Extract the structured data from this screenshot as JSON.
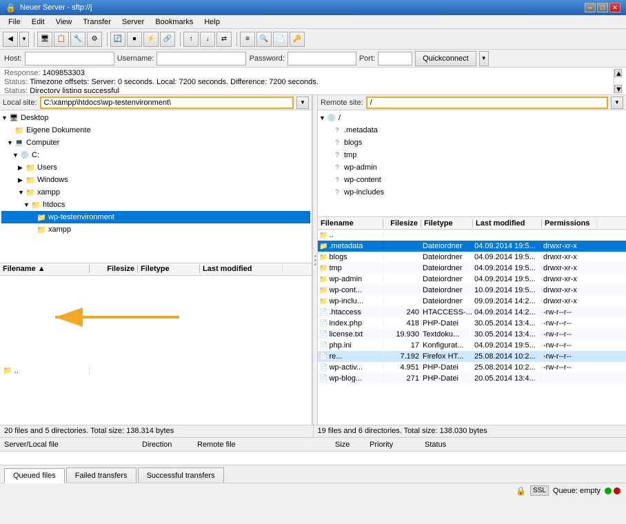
{
  "titlebar": {
    "title": "Neuer Server - sftp://j",
    "min_btn": "─",
    "max_btn": "□",
    "close_btn": "✕"
  },
  "menubar": {
    "items": [
      "File",
      "Edit",
      "View",
      "Transfer",
      "Server",
      "Bookmarks",
      "Help"
    ]
  },
  "connection": {
    "host_label": "Host:",
    "username_label": "Username:",
    "password_label": "Password:",
    "port_label": "Port:",
    "quickconnect_label": "Quickconnect",
    "host_value": "",
    "username_value": "",
    "password_value": "",
    "port_value": ""
  },
  "log": {
    "lines": [
      {
        "label": "Response:",
        "value": "1409853303"
      },
      {
        "label": "Status:",
        "value": "Timezone offsets: Server: 0 seconds. Local: 7200 seconds. Difference: 7200 seconds."
      },
      {
        "label": "Status:",
        "value": "Directory listing successful"
      }
    ]
  },
  "local_site": {
    "label": "Local site:",
    "value": "C:\\xampp\\htdocs\\wp-testenvironment\\"
  },
  "remote_site": {
    "label": "Remote site:",
    "value": "/"
  },
  "local_tree": {
    "items": [
      {
        "indent": 0,
        "label": "Desktop",
        "type": "desktop",
        "expanded": true
      },
      {
        "indent": 1,
        "label": "Eigene Dokumente",
        "type": "folder"
      },
      {
        "indent": 1,
        "label": "Computer",
        "type": "computer",
        "expanded": true
      },
      {
        "indent": 2,
        "label": "C:",
        "type": "drive",
        "expanded": true
      },
      {
        "indent": 3,
        "label": "Users",
        "type": "folder"
      },
      {
        "indent": 3,
        "label": "Windows",
        "type": "folder"
      },
      {
        "indent": 3,
        "label": "xampp",
        "type": "folder",
        "expanded": true
      },
      {
        "indent": 4,
        "label": "htdocs",
        "type": "folder",
        "expanded": true
      },
      {
        "indent": 5,
        "label": "wp-testenvironment",
        "type": "folder",
        "selected": true
      },
      {
        "indent": 5,
        "label": "xampp",
        "type": "folder"
      }
    ]
  },
  "local_files": {
    "columns": [
      "Filename",
      "Filesize",
      "Filetype",
      "Last modified"
    ],
    "rows": [
      {
        "name": "..",
        "size": "",
        "type": "",
        "modified": ""
      }
    ]
  },
  "remote_tree": {
    "items": [
      {
        "indent": 0,
        "label": "/",
        "type": "drive",
        "expanded": true
      },
      {
        "indent": 1,
        "label": ".metadata",
        "type": "question"
      },
      {
        "indent": 1,
        "label": "blogs",
        "type": "question"
      },
      {
        "indent": 1,
        "label": "tmp",
        "type": "question"
      },
      {
        "indent": 1,
        "label": "wp-admin",
        "type": "question"
      },
      {
        "indent": 1,
        "label": "wp-content",
        "type": "question"
      },
      {
        "indent": 1,
        "label": "wp-includes",
        "type": "question"
      }
    ]
  },
  "remote_files": {
    "columns": [
      "Filename",
      "Filesize",
      "Filetype",
      "Last modified",
      "Permissions"
    ],
    "rows": [
      {
        "name": "..",
        "size": "",
        "type": "",
        "modified": "",
        "perms": "",
        "folder": true
      },
      {
        "name": ".metadata",
        "size": "",
        "type": "Dateiordner",
        "modified": "04.09.2014 19:5...",
        "perms": "drwxr-xr-x",
        "folder": true,
        "selected": true
      },
      {
        "name": "blogs",
        "size": "",
        "type": "Dateiordner",
        "modified": "04.09.2014 19:5...",
        "perms": "drwxr-xr-x",
        "folder": true
      },
      {
        "name": "tmp",
        "size": "",
        "type": "Dateiordner",
        "modified": "04.09.2014 19:5...",
        "perms": "drwxr-xr-x",
        "folder": true,
        "alt": true
      },
      {
        "name": "wp-admin",
        "size": "",
        "type": "Dateiordner",
        "modified": "04.09.2014 19:5...",
        "perms": "drwxr-xr-x",
        "folder": true
      },
      {
        "name": "wp-cont...",
        "size": "",
        "type": "Dateiordner",
        "modified": "10.09.2014 19:5...",
        "perms": "drwxr-xr-x",
        "folder": true,
        "alt": true
      },
      {
        "name": "wp-inclu...",
        "size": "",
        "type": "Dateiordner",
        "modified": "09.09.2014 14:2...",
        "perms": "drwxr-xr-x",
        "folder": true
      },
      {
        "name": ".htaccess",
        "size": "240",
        "type": "HTACCESS-...",
        "modified": "04.09.2014 14:2...",
        "perms": "-rw-r--r--",
        "folder": false,
        "alt": true
      },
      {
        "name": "index.php",
        "size": "418",
        "type": "PHP-Datei",
        "modified": "30.05.2014 13:4...",
        "perms": "-rw-r--r--",
        "folder": false
      },
      {
        "name": "license.txt",
        "size": "19.930",
        "type": "Textdoku...",
        "modified": "30.05.2014 13:4...",
        "perms": "-rw-r--r--",
        "folder": false,
        "alt": true
      },
      {
        "name": "php.ini",
        "size": "17",
        "type": "Konfigurat...",
        "modified": "04.09.2014 19:5...",
        "perms": "-rw-r--r--",
        "folder": false
      },
      {
        "name": "re...",
        "size": "7.192",
        "type": "Firefox HT...",
        "modified": "25.08.2014 10:2...",
        "perms": "-rw-r--r--",
        "folder": false,
        "alt": true,
        "partial": true
      },
      {
        "name": "wp-activ...",
        "size": "4.951",
        "type": "PHP-Datei",
        "modified": "25.08.2014 10:2...",
        "perms": "-rw-r--r--",
        "folder": false
      },
      {
        "name": "wp-blog...",
        "size": "271",
        "type": "PHP-Datei",
        "modified": "20.05.2014 13:4...",
        "perms": "",
        "folder": false,
        "alt": true
      }
    ]
  },
  "status": {
    "left": "20 files and 5 directories. Total size: 138.314 bytes",
    "right": "19 files and 6 directories. Total size: 138.030 bytes"
  },
  "queue": {
    "columns": [
      "Server/Local file",
      "Direction",
      "Remote file",
      "Size",
      "Priority",
      "Status"
    ],
    "tabs": [
      "Queued files",
      "Failed transfers",
      "Successful transfers"
    ],
    "active_tab": "Queued files",
    "status": "Queue: empty"
  }
}
